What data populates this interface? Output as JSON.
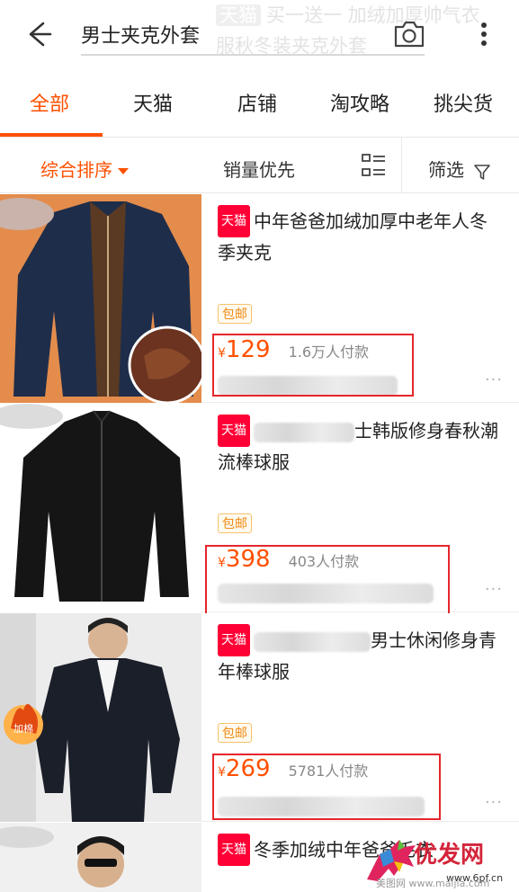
{
  "header": {
    "query": "男士夹克外套",
    "background_promo_tag": "天猫",
    "background_promo_line1": "买一送一 加绒加厚帅气衣",
    "background_promo_line2": "服秋冬装夹克外套"
  },
  "tabs": [
    {
      "label": "全部",
      "active": true
    },
    {
      "label": "天猫",
      "active": false
    },
    {
      "label": "店铺",
      "active": false
    },
    {
      "label": "淘攻略",
      "active": false
    },
    {
      "label": "挑尖货",
      "active": false
    }
  ],
  "filters": {
    "sort": "综合排序",
    "sales_first": "销量优先",
    "filter": "筛选"
  },
  "products": [
    {
      "tag": "天猫",
      "title": "中年爸爸加绒加厚中老年人冬季夹克",
      "title_prefix_blurred": false,
      "badge": "包邮",
      "currency": "¥",
      "price": "129",
      "sales": "1.6万人付款",
      "more": "···",
      "color": "navy"
    },
    {
      "tag": "天猫",
      "title": "士韩版修身春秋潮流棒球服",
      "title_prefix_blurred": true,
      "badge": "包邮",
      "currency": "¥",
      "price": "398",
      "sales": "403人付款",
      "more": "···",
      "color": "black"
    },
    {
      "tag": "天猫",
      "title": "男士休闲修身青年棒球服",
      "title_prefix_blurred": true,
      "badge": "包邮",
      "currency": "¥",
      "price": "269",
      "sales": "5781人付款",
      "more": "···",
      "color": "black"
    },
    {
      "tag": "天猫",
      "title": "冬季加绒中年爸爸毛衣",
      "title_prefix_blurred": false,
      "color": "black"
    }
  ],
  "thumb_overlay_text": "加棉",
  "watermark": {
    "text": "优发网",
    "url": "www.6pf.cn",
    "site": "美图网 www.maijia.com"
  },
  "colors": {
    "accent": "#ff5000",
    "tmall_red": "#ff0036",
    "annotation_red": "#e5262b"
  }
}
